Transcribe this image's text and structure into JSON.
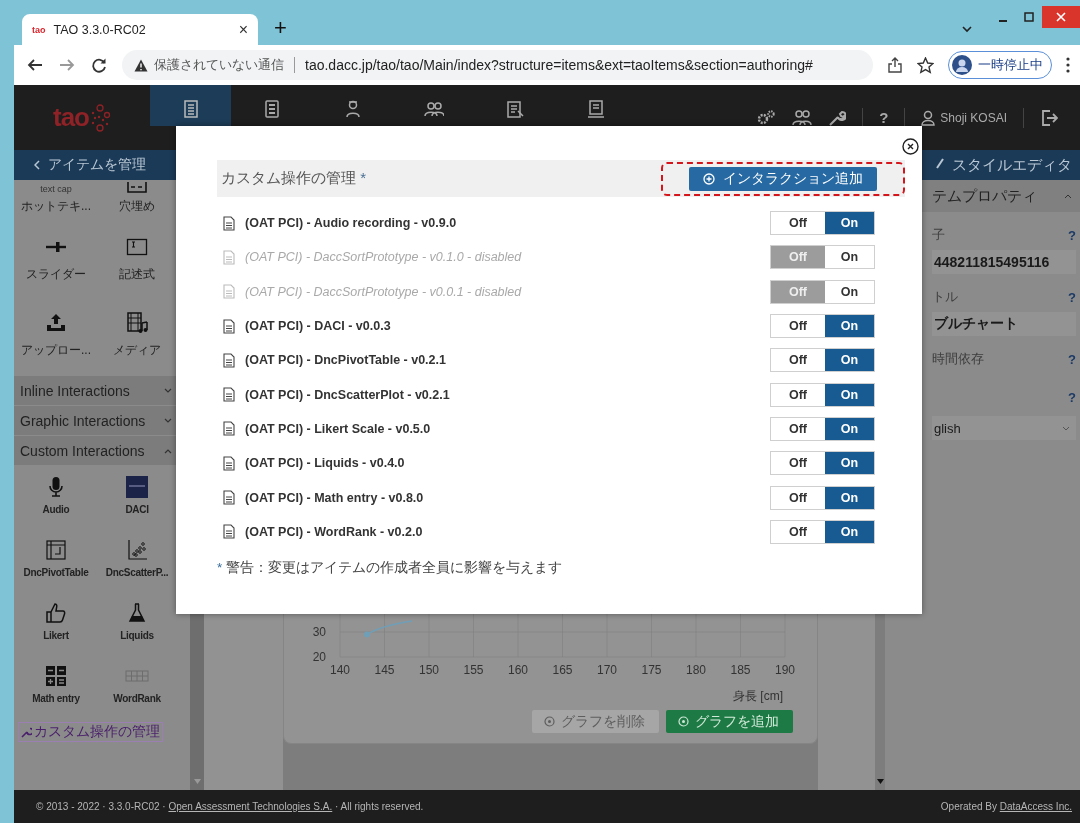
{
  "browser": {
    "tab_logo": "tao",
    "tab_title": "TAO 3.3.0-RC02",
    "tab_close": "×",
    "new_tab": "+",
    "security": "保護されていない通信",
    "url": "tao.dacc.jp/tao/tao/Main/index?structure=items&ext=taoItems&section=authoring#",
    "profile_status": "一時停止中"
  },
  "header": {
    "logo": "tao",
    "nav": [
      {
        "kind": "items",
        "selected": true
      },
      {
        "kind": "tests",
        "selected": false
      },
      {
        "kind": "testtakers",
        "selected": false
      },
      {
        "kind": "groups",
        "selected": false
      },
      {
        "kind": "deliveries",
        "selected": false
      },
      {
        "kind": "results",
        "selected": false
      }
    ],
    "help": "?",
    "user": "Shoji KOSAI"
  },
  "left_panel": {
    "back": "アイテムを管理",
    "tools": [
      {
        "kind": "hottext",
        "icon_text": "text cap",
        "label": "ホットテキ..."
      },
      {
        "kind": "gap",
        "label": "穴埋め"
      },
      {
        "kind": "slider",
        "label": "スライダー"
      },
      {
        "kind": "textbox",
        "label": "記述式"
      },
      {
        "kind": "upload",
        "label": "アップロー..."
      },
      {
        "kind": "media",
        "label": "メディア"
      }
    ],
    "sections": [
      {
        "label": "Inline Interactions",
        "expanded": false
      },
      {
        "label": "Graphic Interactions",
        "expanded": false
      },
      {
        "label": "Custom Interactions",
        "expanded": true
      }
    ],
    "custom_tools": [
      {
        "kind": "audio",
        "label": "Audio"
      },
      {
        "kind": "daci",
        "label": "DACI"
      },
      {
        "kind": "pivot",
        "label": "DncPivotTable"
      },
      {
        "kind": "scatter",
        "label": "DncScatterP..."
      },
      {
        "kind": "likert",
        "label": "Likert"
      },
      {
        "kind": "liquids",
        "label": "Liquids"
      },
      {
        "kind": "math",
        "label": "Math entry"
      },
      {
        "kind": "wordrank",
        "label": "WordRank"
      }
    ],
    "manage_link": "カスタム操作の管理"
  },
  "center": {
    "chart": {
      "y_ticks": [
        "30",
        "20"
      ],
      "x_ticks": [
        "140",
        "145",
        "150",
        "155",
        "160",
        "165",
        "170",
        "175",
        "180",
        "185",
        "190"
      ],
      "x_title": "身長 [cm]"
    },
    "buttons": [
      {
        "label": "グラフを削除",
        "disabled": true
      },
      {
        "label": "グラフを追加",
        "disabled": false
      }
    ]
  },
  "right_panel": {
    "title": "スタイルエディタ",
    "section": {
      "label": "テムプロパティ",
      "expanded": true
    },
    "props": [
      {
        "kind": "label",
        "text": "子",
        "help": "?"
      },
      {
        "kind": "input",
        "value": "448211815495116"
      },
      {
        "kind": "label",
        "text": "トル",
        "help": "?"
      },
      {
        "kind": "input",
        "value": "ブルチャート"
      },
      {
        "kind": "label",
        "text": "時間依存",
        "help": "?"
      },
      {
        "kind": "label",
        "help": "?"
      },
      {
        "kind": "select",
        "value": "glish"
      }
    ]
  },
  "modal": {
    "title": "カスタム操作の管理",
    "title_mark": "*",
    "add_button": "インタラクション追加",
    "add_button_highlighted": true,
    "rows": [
      {
        "label": "(OAT PCI) - Audio recording - v0.9.0",
        "disabled": false,
        "on": true,
        "off_text": "Off",
        "on_text": "On"
      },
      {
        "label": "(OAT PCI) - DaccSortPrototype - v0.1.0 - disabled",
        "disabled": true,
        "on": false,
        "off_text": "Off",
        "on_text": "On"
      },
      {
        "label": "(OAT PCI) - DaccSortPrototype - v0.0.1 - disabled",
        "disabled": true,
        "on": false,
        "off_text": "Off",
        "on_text": "On"
      },
      {
        "label": "(OAT PCI) - DACI - v0.0.3",
        "disabled": false,
        "on": true,
        "off_text": "Off",
        "on_text": "On"
      },
      {
        "label": "(OAT PCI) - DncPivotTable - v0.2.1",
        "disabled": false,
        "on": true,
        "off_text": "Off",
        "on_text": "On"
      },
      {
        "label": "(OAT PCI) - DncScatterPlot - v0.2.1",
        "disabled": false,
        "on": true,
        "off_text": "Off",
        "on_text": "On"
      },
      {
        "label": "(OAT PCI) - Likert Scale - v0.5.0",
        "disabled": false,
        "on": true,
        "off_text": "Off",
        "on_text": "On"
      },
      {
        "label": "(OAT PCI) - Liquids - v0.4.0",
        "disabled": false,
        "on": true,
        "off_text": "Off",
        "on_text": "On"
      },
      {
        "label": "(OAT PCI) - Math entry - v0.8.0",
        "disabled": false,
        "on": true,
        "off_text": "Off",
        "on_text": "On"
      },
      {
        "label": "(OAT PCI) - WordRank - v0.2.0",
        "disabled": false,
        "on": true,
        "off_text": "Off",
        "on_text": "On"
      }
    ],
    "note_mark": "*",
    "note": "警告：変更はアイテムの作成者全員に影響を与えます"
  },
  "footer": {
    "left_prefix": "© 2013 - 2022 · 3.3.0-RC02 · ",
    "left_link": "Open Assessment Technologies S.A.",
    "left_suffix": " · All rights reserved.",
    "right_prefix": "Operated By ",
    "right_link": "DataAccess Inc."
  }
}
